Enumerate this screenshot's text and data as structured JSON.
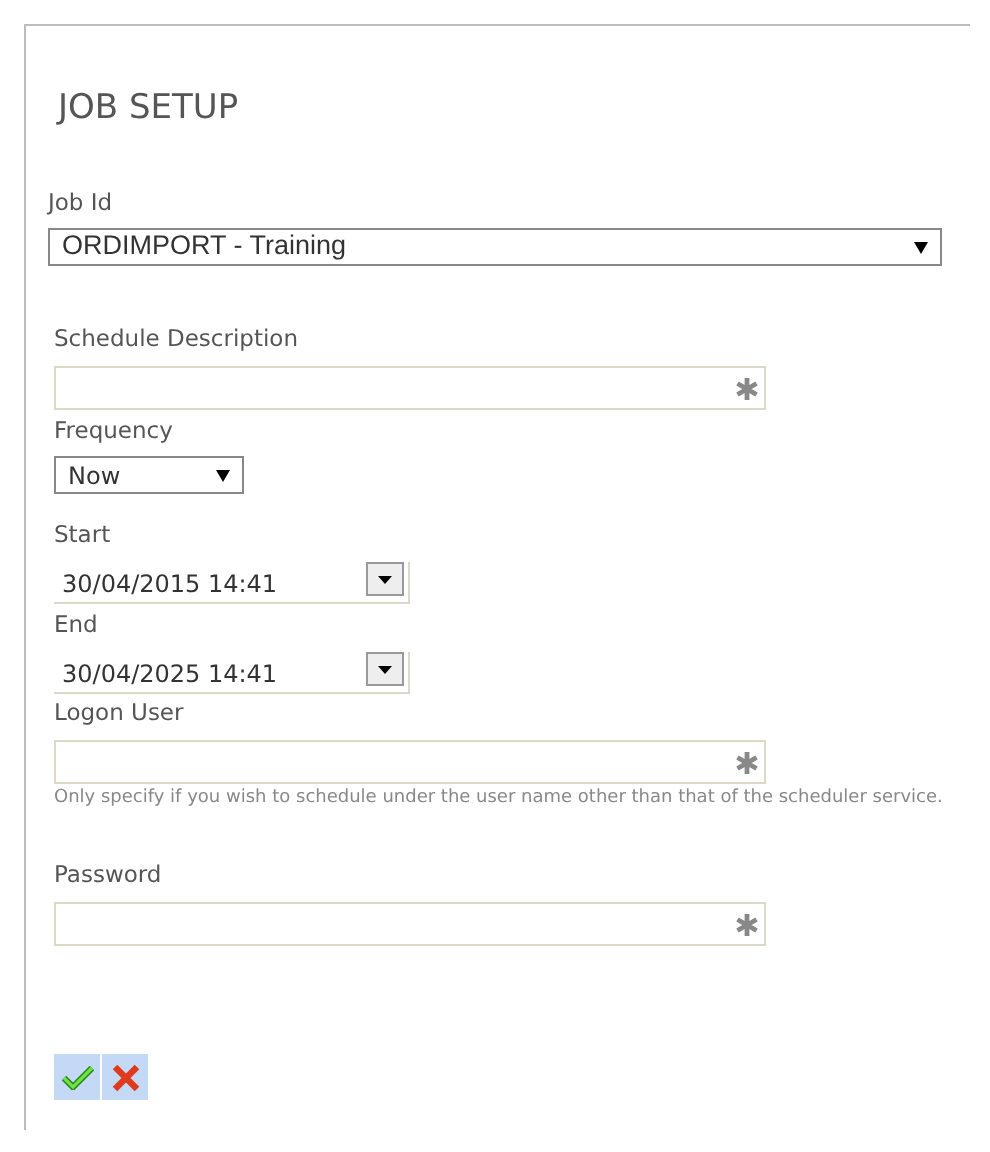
{
  "title": "JOB SETUP",
  "fields": [
    {
      "kind": "select",
      "label": "Job Id",
      "value": "ORDIMPORT - Training"
    },
    {
      "kind": "text",
      "label": "Schedule Description",
      "required": true
    },
    {
      "kind": "dropdown",
      "label": "Frequency",
      "value": "Now"
    },
    {
      "kind": "date",
      "label": "Start",
      "value": "30/04/2015 14:41"
    },
    {
      "kind": "date",
      "label": "End",
      "value": "30/04/2025 14:41"
    },
    {
      "kind": "text",
      "label": "Logon User",
      "required": true,
      "help": "Only specify if you wish to schedule under the user name other than that of the scheduler service."
    },
    {
      "kind": "password",
      "label": "Password",
      "required": true
    }
  ],
  "buttons": [
    {
      "kind": "ok"
    },
    {
      "kind": "cancel"
    }
  ]
}
